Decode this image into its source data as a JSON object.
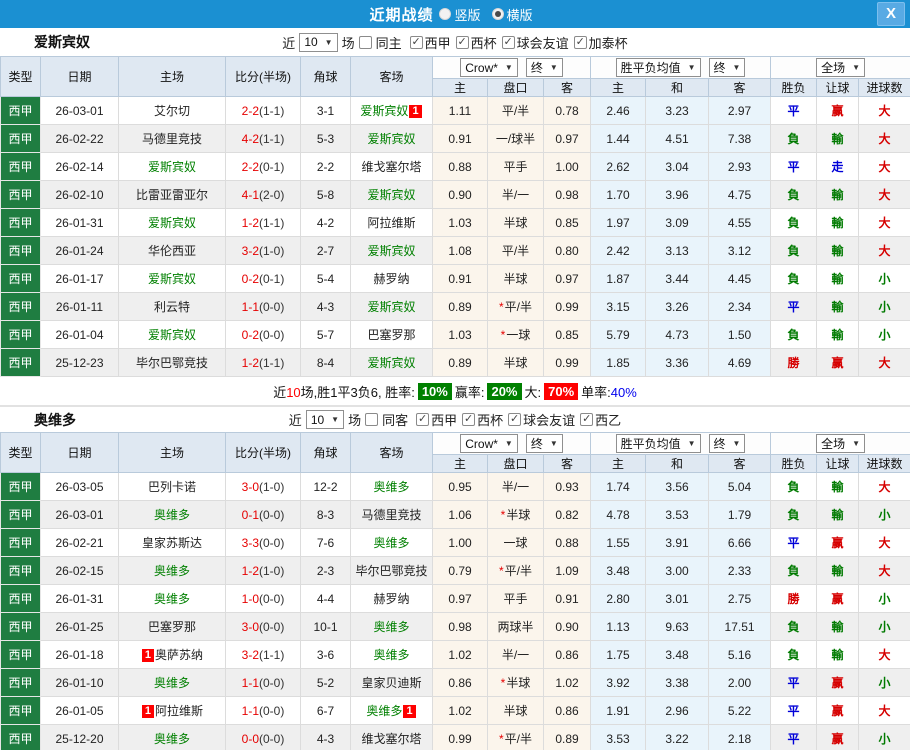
{
  "titlebar": {
    "title": "近期战绩",
    "radio_vertical": "竖版",
    "radio_horizontal": "横版",
    "close_label": "X"
  },
  "table_headers": {
    "col_type": "类型",
    "col_date": "日期",
    "col_home": "主场",
    "col_score": "比分(半场)",
    "col_corner": "角球",
    "col_away": "客场",
    "dd_crow": "Crow*",
    "dd_final1": "终",
    "dd_avg": "胜平负均值",
    "dd_final2": "终",
    "dd_fulltime": "全场",
    "sub": [
      "主",
      "盘口",
      "客",
      "主",
      "和",
      "客",
      "胜负",
      "让球",
      "进球数"
    ]
  },
  "colors": {
    "titlebar_blue": "#1b90d2",
    "type_green": "#1f7d41",
    "team_green": "#008000",
    "score_red": "#e60000",
    "result_colors": {
      "勝": "#d60000",
      "平": "#0000d8",
      "負": "#007a00",
      "赢": "#d60000",
      "輸": "#007a00",
      "走": "#0000d8",
      "大": "#d60000",
      "小": "#007a00"
    }
  },
  "sections": [
    {
      "team": "爱斯宾奴",
      "filter": {
        "near_label": "近",
        "count": "10",
        "games_label": "场",
        "same_checked": false,
        "same_label": "同主",
        "leagues": [
          "西甲",
          "西杯",
          "球会友谊",
          "加泰杯"
        ]
      },
      "rows": [
        {
          "league": "西甲",
          "date": "26-03-01",
          "home": "艾尔切",
          "home_is_team": false,
          "home_badge": null,
          "score_ft": "2-2",
          "score_ht": "(1-1)",
          "corners": "3-1",
          "away": "爱斯宾奴",
          "away_is_team": true,
          "away_badge": "1",
          "odds_home": "1.11",
          "handicap": "平/半",
          "handicap_star": false,
          "odds_away": "0.78",
          "avg_home": "2.46",
          "avg_draw": "3.23",
          "avg_away": "2.97",
          "res_wdl": "平",
          "res_handicap": "赢",
          "res_goals": "大"
        },
        {
          "league": "西甲",
          "date": "26-02-22",
          "home": "马德里竞技",
          "home_is_team": false,
          "home_badge": null,
          "score_ft": "4-2",
          "score_ht": "(1-1)",
          "corners": "5-3",
          "away": "爱斯宾奴",
          "away_is_team": true,
          "away_badge": null,
          "odds_home": "0.91",
          "handicap": "一/球半",
          "handicap_star": false,
          "odds_away": "0.97",
          "avg_home": "1.44",
          "avg_draw": "4.51",
          "avg_away": "7.38",
          "res_wdl": "負",
          "res_handicap": "輸",
          "res_goals": "大"
        },
        {
          "league": "西甲",
          "date": "26-02-14",
          "home": "爱斯宾奴",
          "home_is_team": true,
          "home_badge": null,
          "score_ft": "2-2",
          "score_ht": "(0-1)",
          "corners": "2-2",
          "away": "维戈塞尔塔",
          "away_is_team": false,
          "away_badge": null,
          "odds_home": "0.88",
          "handicap": "平手",
          "handicap_star": false,
          "odds_away": "1.00",
          "avg_home": "2.62",
          "avg_draw": "3.04",
          "avg_away": "2.93",
          "res_wdl": "平",
          "res_handicap": "走",
          "res_goals": "大"
        },
        {
          "league": "西甲",
          "date": "26-02-10",
          "home": "比雷亚雷亚尔",
          "home_is_team": false,
          "home_badge": null,
          "score_ft": "4-1",
          "score_ht": "(2-0)",
          "corners": "5-8",
          "away": "爱斯宾奴",
          "away_is_team": true,
          "away_badge": null,
          "odds_home": "0.90",
          "handicap": "半/一",
          "handicap_star": false,
          "odds_away": "0.98",
          "avg_home": "1.70",
          "avg_draw": "3.96",
          "avg_away": "4.75",
          "res_wdl": "負",
          "res_handicap": "輸",
          "res_goals": "大"
        },
        {
          "league": "西甲",
          "date": "26-01-31",
          "home": "爱斯宾奴",
          "home_is_team": true,
          "home_badge": null,
          "score_ft": "1-2",
          "score_ht": "(1-1)",
          "corners": "4-2",
          "away": "阿拉维斯",
          "away_is_team": false,
          "away_badge": null,
          "odds_home": "1.03",
          "handicap": "半球",
          "handicap_star": false,
          "odds_away": "0.85",
          "avg_home": "1.97",
          "avg_draw": "3.09",
          "avg_away": "4.55",
          "res_wdl": "負",
          "res_handicap": "輸",
          "res_goals": "大"
        },
        {
          "league": "西甲",
          "date": "26-01-24",
          "home": "华伦西亚",
          "home_is_team": false,
          "home_badge": null,
          "score_ft": "3-2",
          "score_ht": "(1-0)",
          "corners": "2-7",
          "away": "爱斯宾奴",
          "away_is_team": true,
          "away_badge": null,
          "odds_home": "1.08",
          "handicap": "平/半",
          "handicap_star": false,
          "odds_away": "0.80",
          "avg_home": "2.42",
          "avg_draw": "3.13",
          "avg_away": "3.12",
          "res_wdl": "負",
          "res_handicap": "輸",
          "res_goals": "大"
        },
        {
          "league": "西甲",
          "date": "26-01-17",
          "home": "爱斯宾奴",
          "home_is_team": true,
          "home_badge": null,
          "score_ft": "0-2",
          "score_ht": "(0-1)",
          "corners": "5-4",
          "away": "赫罗纳",
          "away_is_team": false,
          "away_badge": null,
          "odds_home": "0.91",
          "handicap": "半球",
          "handicap_star": false,
          "odds_away": "0.97",
          "avg_home": "1.87",
          "avg_draw": "3.44",
          "avg_away": "4.45",
          "res_wdl": "負",
          "res_handicap": "輸",
          "res_goals": "小"
        },
        {
          "league": "西甲",
          "date": "26-01-11",
          "home": "利云特",
          "home_is_team": false,
          "home_badge": null,
          "score_ft": "1-1",
          "score_ht": "(0-0)",
          "corners": "4-3",
          "away": "爱斯宾奴",
          "away_is_team": true,
          "away_badge": null,
          "odds_home": "0.89",
          "handicap": "平/半",
          "handicap_star": true,
          "odds_away": "0.99",
          "avg_home": "3.15",
          "avg_draw": "3.26",
          "avg_away": "2.34",
          "res_wdl": "平",
          "res_handicap": "輸",
          "res_goals": "小"
        },
        {
          "league": "西甲",
          "date": "26-01-04",
          "home": "爱斯宾奴",
          "home_is_team": true,
          "home_badge": null,
          "score_ft": "0-2",
          "score_ht": "(0-0)",
          "corners": "5-7",
          "away": "巴塞罗那",
          "away_is_team": false,
          "away_badge": null,
          "odds_home": "1.03",
          "handicap": "一球",
          "handicap_star": true,
          "odds_away": "0.85",
          "avg_home": "5.79",
          "avg_draw": "4.73",
          "avg_away": "1.50",
          "res_wdl": "負",
          "res_handicap": "輸",
          "res_goals": "小"
        },
        {
          "league": "西甲",
          "date": "25-12-23",
          "home": "毕尔巴鄂竞技",
          "home_is_team": false,
          "home_badge": null,
          "score_ft": "1-2",
          "score_ht": "(1-1)",
          "corners": "8-4",
          "away": "爱斯宾奴",
          "away_is_team": true,
          "away_badge": null,
          "odds_home": "0.89",
          "handicap": "半球",
          "handicap_star": false,
          "odds_away": "0.99",
          "avg_home": "1.85",
          "avg_draw": "3.36",
          "avg_away": "4.69",
          "res_wdl": "勝",
          "res_handicap": "赢",
          "res_goals": "大"
        }
      ],
      "summary": {
        "prefix": "近",
        "count": "10",
        "mid": "场,胜1平3负6, 胜率:",
        "win_rate": "10%",
        "handicap_label": "赢率:",
        "handicap_rate": "20%",
        "big_label": "大:",
        "big_rate": "70%",
        "single_label": "单率:",
        "single_rate": "40%"
      }
    },
    {
      "team": "奥维多",
      "filter": {
        "near_label": "近",
        "count": "10",
        "games_label": "场",
        "same_checked": false,
        "same_label": "同客",
        "leagues": [
          "西甲",
          "西杯",
          "球会友谊",
          "西乙"
        ]
      },
      "rows": [
        {
          "league": "西甲",
          "date": "26-03-05",
          "home": "巴列卡诺",
          "home_is_team": false,
          "home_badge": null,
          "score_ft": "3-0",
          "score_ht": "(1-0)",
          "corners": "12-2",
          "away": "奥维多",
          "away_is_team": true,
          "away_badge": null,
          "odds_home": "0.95",
          "handicap": "半/一",
          "handicap_star": false,
          "odds_away": "0.93",
          "avg_home": "1.74",
          "avg_draw": "3.56",
          "avg_away": "5.04",
          "res_wdl": "負",
          "res_handicap": "輸",
          "res_goals": "大"
        },
        {
          "league": "西甲",
          "date": "26-03-01",
          "home": "奥维多",
          "home_is_team": true,
          "home_badge": null,
          "score_ft": "0-1",
          "score_ht": "(0-0)",
          "corners": "8-3",
          "away": "马德里竞技",
          "away_is_team": false,
          "away_badge": null,
          "odds_home": "1.06",
          "handicap": "半球",
          "handicap_star": true,
          "odds_away": "0.82",
          "avg_home": "4.78",
          "avg_draw": "3.53",
          "avg_away": "1.79",
          "res_wdl": "負",
          "res_handicap": "輸",
          "res_goals": "小"
        },
        {
          "league": "西甲",
          "date": "26-02-21",
          "home": "皇家苏斯达",
          "home_is_team": false,
          "home_badge": null,
          "score_ft": "3-3",
          "score_ht": "(0-0)",
          "corners": "7-6",
          "away": "奥维多",
          "away_is_team": true,
          "away_badge": null,
          "odds_home": "1.00",
          "handicap": "一球",
          "handicap_star": false,
          "odds_away": "0.88",
          "avg_home": "1.55",
          "avg_draw": "3.91",
          "avg_away": "6.66",
          "res_wdl": "平",
          "res_handicap": "赢",
          "res_goals": "大"
        },
        {
          "league": "西甲",
          "date": "26-02-15",
          "home": "奥维多",
          "home_is_team": true,
          "home_badge": null,
          "score_ft": "1-2",
          "score_ht": "(1-0)",
          "corners": "2-3",
          "away": "毕尔巴鄂竞技",
          "away_is_team": false,
          "away_badge": null,
          "odds_home": "0.79",
          "handicap": "平/半",
          "handicap_star": true,
          "odds_away": "1.09",
          "avg_home": "3.48",
          "avg_draw": "3.00",
          "avg_away": "2.33",
          "res_wdl": "負",
          "res_handicap": "輸",
          "res_goals": "大"
        },
        {
          "league": "西甲",
          "date": "26-01-31",
          "home": "奥维多",
          "home_is_team": true,
          "home_badge": null,
          "score_ft": "1-0",
          "score_ht": "(0-0)",
          "corners": "4-4",
          "away": "赫罗纳",
          "away_is_team": false,
          "away_badge": null,
          "odds_home": "0.97",
          "handicap": "平手",
          "handicap_star": false,
          "odds_away": "0.91",
          "avg_home": "2.80",
          "avg_draw": "3.01",
          "avg_away": "2.75",
          "res_wdl": "勝",
          "res_handicap": "赢",
          "res_goals": "小"
        },
        {
          "league": "西甲",
          "date": "26-01-25",
          "home": "巴塞罗那",
          "home_is_team": false,
          "home_badge": null,
          "score_ft": "3-0",
          "score_ht": "(0-0)",
          "corners": "10-1",
          "away": "奥维多",
          "away_is_team": true,
          "away_badge": null,
          "odds_home": "0.98",
          "handicap": "两球半",
          "handicap_star": false,
          "odds_away": "0.90",
          "avg_home": "1.13",
          "avg_draw": "9.63",
          "avg_away": "17.51",
          "res_wdl": "負",
          "res_handicap": "輸",
          "res_goals": "小"
        },
        {
          "league": "西甲",
          "date": "26-01-18",
          "home": "奥萨苏纳",
          "home_is_team": false,
          "home_badge": "1",
          "score_ft": "3-2",
          "score_ht": "(1-1)",
          "corners": "3-6",
          "away": "奥维多",
          "away_is_team": true,
          "away_badge": null,
          "odds_home": "1.02",
          "handicap": "半/一",
          "handicap_star": false,
          "odds_away": "0.86",
          "avg_home": "1.75",
          "avg_draw": "3.48",
          "avg_away": "5.16",
          "res_wdl": "負",
          "res_handicap": "輸",
          "res_goals": "大"
        },
        {
          "league": "西甲",
          "date": "26-01-10",
          "home": "奥维多",
          "home_is_team": true,
          "home_badge": null,
          "score_ft": "1-1",
          "score_ht": "(0-0)",
          "corners": "5-2",
          "away": "皇家贝迪斯",
          "away_is_team": false,
          "away_badge": null,
          "odds_home": "0.86",
          "handicap": "半球",
          "handicap_star": true,
          "odds_away": "1.02",
          "avg_home": "3.92",
          "avg_draw": "3.38",
          "avg_away": "2.00",
          "res_wdl": "平",
          "res_handicap": "赢",
          "res_goals": "小"
        },
        {
          "league": "西甲",
          "date": "26-01-05",
          "home": "阿拉维斯",
          "home_is_team": false,
          "home_badge": "1",
          "score_ft": "1-1",
          "score_ht": "(0-0)",
          "corners": "6-7",
          "away": "奥维多",
          "away_is_team": true,
          "away_badge": "1",
          "odds_home": "1.02",
          "handicap": "半球",
          "handicap_star": false,
          "odds_away": "0.86",
          "avg_home": "1.91",
          "avg_draw": "2.96",
          "avg_away": "5.22",
          "res_wdl": "平",
          "res_handicap": "赢",
          "res_goals": "大"
        },
        {
          "league": "西甲",
          "date": "25-12-20",
          "home": "奥维多",
          "home_is_team": true,
          "home_badge": null,
          "score_ft": "0-0",
          "score_ht": "(0-0)",
          "corners": "4-3",
          "away": "维戈塞尔塔",
          "away_is_team": false,
          "away_badge": null,
          "odds_home": "0.99",
          "handicap": "平/半",
          "handicap_star": true,
          "odds_away": "0.89",
          "avg_home": "3.53",
          "avg_draw": "3.22",
          "avg_away": "2.18",
          "res_wdl": "平",
          "res_handicap": "赢",
          "res_goals": "小"
        }
      ],
      "summary": null
    }
  ]
}
